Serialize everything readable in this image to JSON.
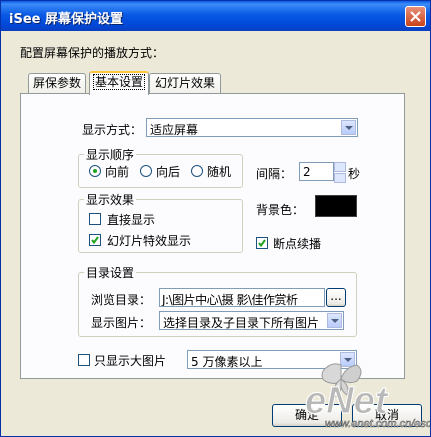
{
  "window": {
    "title": "iSee 屏幕保护设置"
  },
  "prompt": "配置屏幕保护的播放方式：",
  "tabs": [
    {
      "label": "屏保参数"
    },
    {
      "label": "基本设置"
    },
    {
      "label": "幻灯片效果"
    }
  ],
  "display_mode": {
    "label": "显示方式：",
    "value": "适应屏幕"
  },
  "order_group": {
    "legend": "显示顺序",
    "options": [
      {
        "label": "向前",
        "selected": true
      },
      {
        "label": "向后",
        "selected": false
      },
      {
        "label": "随机",
        "selected": false
      }
    ]
  },
  "interval": {
    "label": "间隔：",
    "value": "2",
    "unit": "秒"
  },
  "effect_group": {
    "legend": "显示效果",
    "direct_label": "直接显示",
    "direct_checked": false,
    "slideshow_label": "幻灯片特效显示",
    "slideshow_checked": true
  },
  "background": {
    "label": "背景色：",
    "color": "#000000"
  },
  "resume": {
    "label": "断点续播",
    "checked": true
  },
  "dir_group": {
    "legend": "目录设置",
    "browse_label": "浏览目录：",
    "browse_value": "J:\\图片中心\\摄  影\\佳作赏析",
    "browse_button": "...",
    "show_label": "显示图片：",
    "show_value": "选择目录及子目录下所有图片"
  },
  "large_only": {
    "label": "只显示大图片",
    "checked": false,
    "value": "5 万像素以上"
  },
  "footer": {
    "ok_label": "确定",
    "cancel_label": "取消",
    "watermark_main": "eNet",
    "watermark_url": "www.enet.com.cn/eschool"
  }
}
